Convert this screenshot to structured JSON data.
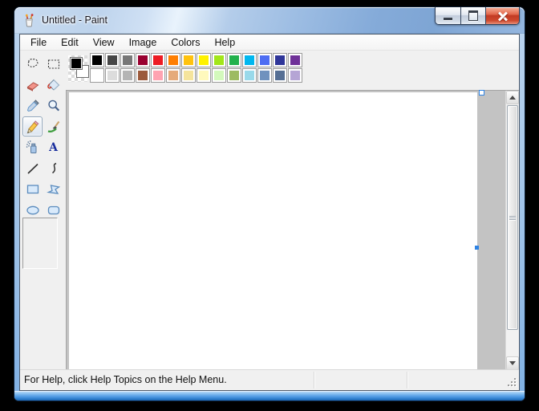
{
  "window": {
    "title": "Untitled - Paint",
    "app_icon": "paint-brush-cup-icon",
    "controls": {
      "minimize": "minimize-button",
      "maximize": "maximize-button",
      "close": "close-button"
    }
  },
  "menu": {
    "items": [
      "File",
      "Edit",
      "View",
      "Image",
      "Colors",
      "Help"
    ]
  },
  "toolbox": {
    "tools": [
      "free-form-select",
      "select",
      "eraser",
      "fill-with-color",
      "pick-color",
      "magnifier",
      "pencil",
      "brush",
      "airbrush",
      "text",
      "line",
      "curve",
      "rectangle",
      "polygon",
      "ellipse",
      "rounded-rectangle"
    ],
    "selected_tool": "pencil",
    "text_tool_glyph": "A"
  },
  "palette": {
    "foreground_color": "#000000",
    "background_color": "#FFFFFF",
    "row1": [
      "#000000",
      "#464646",
      "#787878",
      "#990030",
      "#ED1C24",
      "#FF7E00",
      "#FFC20E",
      "#FFF200",
      "#A2E61B",
      "#22B14C",
      "#00B7EF",
      "#4D6DF3",
      "#2F3699",
      "#6F3198"
    ],
    "row2": [
      "#FFFFFF",
      "#DCDCDC",
      "#B4B4B4",
      "#9C5A3C",
      "#FFA3B1",
      "#E5AA7A",
      "#F5E49C",
      "#FFF9BD",
      "#D3F9BC",
      "#9DBB61",
      "#99D9EA",
      "#7092BE",
      "#566F94",
      "#B5A5D5"
    ]
  },
  "canvas": {
    "handles": [
      "right-middle-handle",
      "top-right-handle"
    ],
    "handle_color": "#2F83E3"
  },
  "scrollbar": {
    "orientation": "vertical",
    "up_arrow": "scroll-up",
    "down_arrow": "scroll-down"
  },
  "statusbar": {
    "help_text": "For Help, click Help Topics on the Help Menu."
  },
  "theme": {
    "title_glass_blue": "#9DBFE4",
    "close_button_red": "#CF4A2E",
    "panel_gray": "#F0F0F0",
    "workspace_gray": "#C3C3C3",
    "desktop_background": "#000000"
  }
}
